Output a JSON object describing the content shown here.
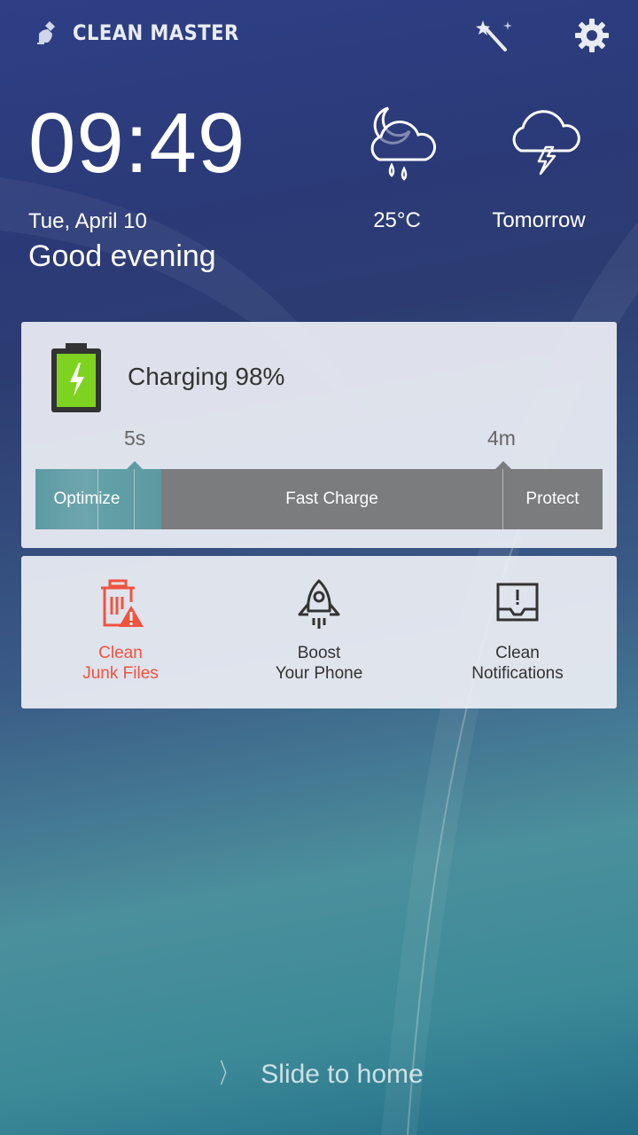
{
  "app": {
    "name": "CLEAN MASTER",
    "logo_icon": "broom-icon"
  },
  "topbar": {
    "magic_icon": "magic-wand-icon",
    "settings_icon": "gear-icon"
  },
  "clock": {
    "time": "09:49",
    "date": "Tue, April 10",
    "greeting": "Good evening"
  },
  "weather": {
    "today": {
      "icon": "cloud-moon-rain-icon",
      "temperature": "25°C"
    },
    "tomorrow": {
      "icon": "cloud-lightning-icon",
      "label": "Tomorrow"
    }
  },
  "charging": {
    "title": "Charging 98%",
    "level_percent": 98,
    "tick_optimize_end": "5s",
    "tick_protect_start": "4m",
    "segments": {
      "optimize": "Optimize",
      "fast_charge": "Fast Charge",
      "protect": "Protect"
    },
    "colors": {
      "battery_fill": "#7ed321",
      "optimize": "#5e9aa2",
      "bar": "#7b7c7e"
    }
  },
  "tools": [
    {
      "line1": "Clean",
      "line2": "Junk Files",
      "icon": "trash-warning-icon",
      "color": "#f0533f"
    },
    {
      "line1": "Boost",
      "line2": "Your Phone",
      "icon": "rocket-icon",
      "color": "#333333"
    },
    {
      "line1": "Clean",
      "line2": "Notifications",
      "icon": "notification-tray-icon",
      "color": "#333333"
    }
  ],
  "slide": {
    "label": "Slide to home"
  }
}
